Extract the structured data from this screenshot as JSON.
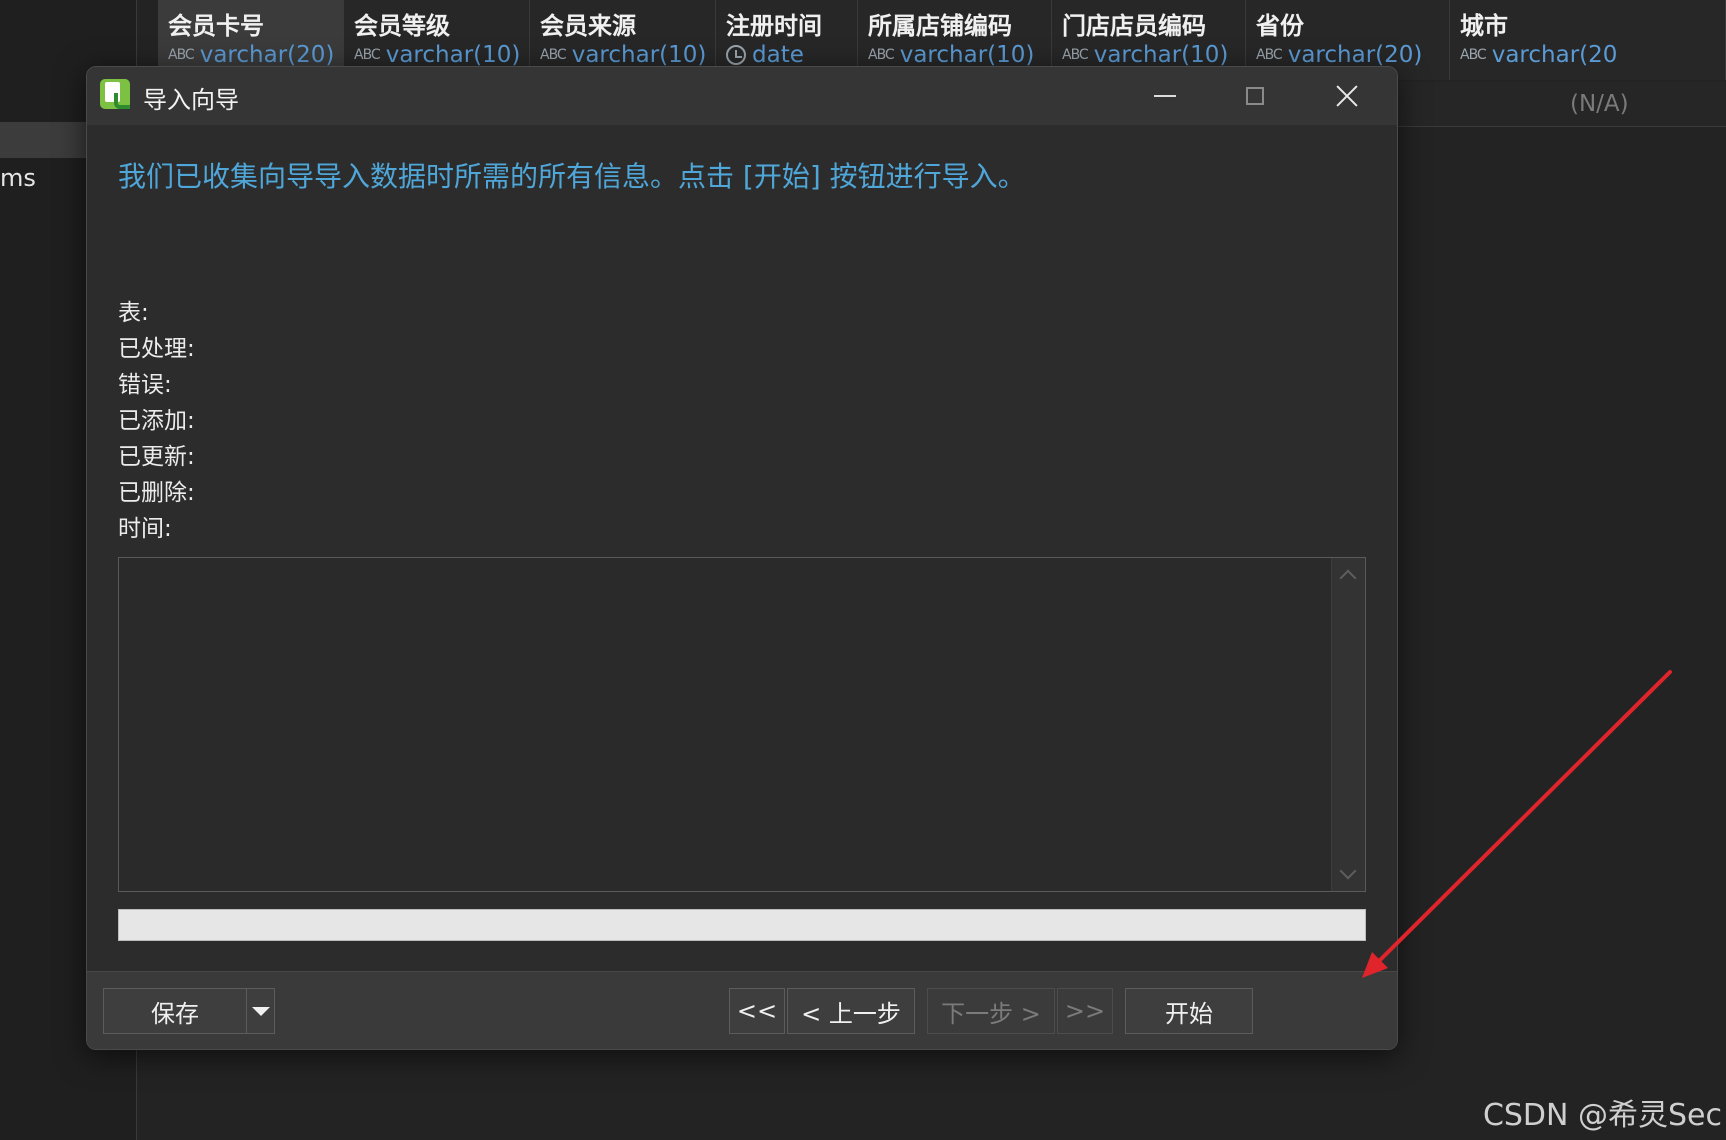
{
  "left_panel": {
    "nav_item_label": "ms"
  },
  "grid": {
    "columns": [
      {
        "name": "会员卡号",
        "type": "varchar(20)",
        "icon": "abc-icon"
      },
      {
        "name": "会员等级",
        "type": "varchar(10)",
        "icon": "abc-icon"
      },
      {
        "name": "会员来源",
        "type": "varchar(10)",
        "icon": "abc-icon"
      },
      {
        "name": "注册时间",
        "type": "date",
        "icon": "clock-icon"
      },
      {
        "name": "所属店铺编码",
        "type": "varchar(10)",
        "icon": "abc-icon"
      },
      {
        "name": "门店店员编码",
        "type": "varchar(10)",
        "icon": "abc-icon"
      },
      {
        "name": "省份",
        "type": "varchar(20)",
        "icon": "abc-icon"
      },
      {
        "name": "城市",
        "type": "varchar(20",
        "icon": "abc-icon"
      }
    ],
    "row_cells": [
      "/A)",
      "(N/A)"
    ],
    "type_icon_text": "ABC"
  },
  "dialog": {
    "title": "导入向导",
    "info_message": "我们已收集向导导入数据时所需的所有信息。点击 [开始] 按钮进行导入。",
    "stats": {
      "table_label": "表:",
      "processed_label": "已处理:",
      "errors_label": "错误:",
      "added_label": "已添加:",
      "updated_label": "已更新:",
      "deleted_label": "已删除:",
      "time_label": "时间:"
    },
    "log_text": "",
    "progress_percent": 0,
    "footer": {
      "save_label": "保存",
      "first_label": "<<",
      "back_label": "< 上一步",
      "next_label": "下一步 >",
      "last_label": ">>",
      "start_label": "开始"
    }
  },
  "annotation": {
    "arrow_color": "#e0242b"
  },
  "watermark": "CSDN @希灵Sec",
  "colors": {
    "accent_text": "#4fa6d8",
    "type_text": "#5b9bd5",
    "app_icon": "#7cc142"
  }
}
